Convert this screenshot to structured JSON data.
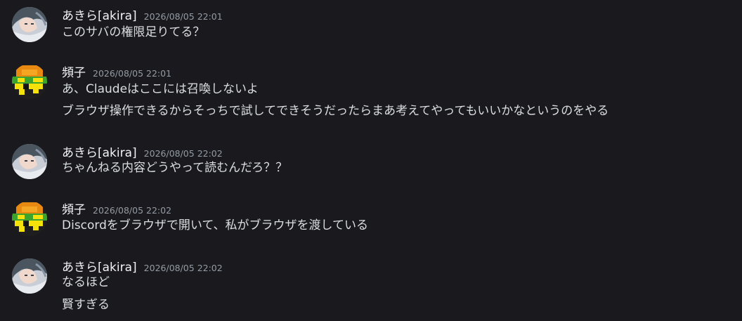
{
  "messages": [
    {
      "author": "あきら[akira]",
      "timestamp": "2026/08/05 22:01",
      "avatar": "anime-girl-avatar",
      "lines": [
        "このサバの権限足りてる？"
      ]
    },
    {
      "author": "頻子",
      "timestamp": "2026/08/05 22:01",
      "avatar": "pixel-art-avatar",
      "lines": [
        "あ、Claudeはここには召喚しないよ",
        "ブラウザ操作できるからそっちで試してできそうだったらまあ考えてやってもいいかなというのをやる"
      ]
    },
    {
      "author": "あきら[akira]",
      "timestamp": "2026/08/05 22:02",
      "avatar": "anime-girl-avatar",
      "lines": [
        "ちゃんねる内容どうやって読むんだろ？？"
      ]
    },
    {
      "author": "頻子",
      "timestamp": "2026/08/05 22:02",
      "avatar": "pixel-art-avatar",
      "lines": [
        "Discordをブラウザで開いて、私がブラウザを渡している"
      ]
    },
    {
      "author": "あきら[akira]",
      "timestamp": "2026/08/05 22:02",
      "avatar": "anime-girl-avatar",
      "lines": [
        "なるほど",
        "賢すぎる"
      ]
    }
  ],
  "colors": {
    "background": "#1a1a1e",
    "text": "#dbdee1",
    "author": "#f2f3f5",
    "timestamp": "#949ba4"
  }
}
